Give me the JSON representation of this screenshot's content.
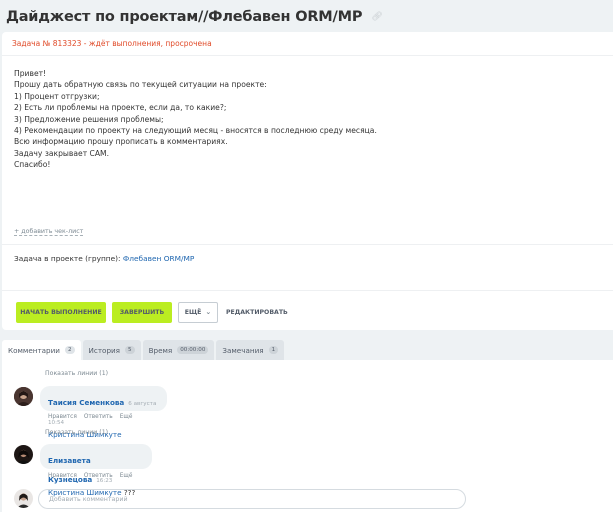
{
  "page": {
    "title": "Дайджест по проектам//Флебавен ORM/MP",
    "link_icon": "link-icon"
  },
  "task": {
    "header": "Задача № 813323 - ждёт выполнения, просрочена",
    "body_lines": [
      "Привет!",
      "",
      "Прошу дать обратную связь по текущей ситуации на проекте:",
      "1) Процент отгрузки;",
      "2) Есть ли проблемы на проекте, если да, то какие?;",
      "3) Предложение решения проблемы;",
      "4) Рекомендации по проекту на следующий месяц - вносятся в последнюю среду месяца.",
      "",
      "Всю информацию прошу прописать в комментариях.",
      "Задачу закрывает САМ.",
      "",
      "Спасибо!"
    ],
    "add_checklist": "+ добавить чек-лист",
    "project_label": "Задача в проекте (группе):",
    "project_name": "Флебавен ORM/MP",
    "buttons": {
      "start": "НАЧАТЬ ВЫПОЛНЕНИЕ",
      "finish": "ЗАВЕРШИТЬ",
      "more": "ЕЩЁ",
      "edit": "РЕДАКТИРОВАТЬ"
    }
  },
  "tabs": [
    {
      "label": "Комментарии",
      "count": "2"
    },
    {
      "label": "История",
      "count": "5"
    },
    {
      "label": "Время",
      "count": "00:00:00"
    },
    {
      "label": "Замечания",
      "count": "1"
    }
  ],
  "comments": {
    "show_more_1": "Показать линии (1)",
    "show_more_2": "Показать линии (1)",
    "items": [
      {
        "author": "Таисия Семенкова",
        "date": "6 августа 10:54",
        "mention": "Кристина Шимкуте",
        "text_after": "",
        "actions": [
          "Нравится",
          "Ответить",
          "Ещё"
        ]
      },
      {
        "author": "Елизавета Кузнецова",
        "date": "16:23",
        "mention": "Кристина Шимкуте",
        "text_after": " ???",
        "actions": [
          "Нравится",
          "Ответить",
          "Ещё"
        ]
      }
    ],
    "add_placeholder": "Добавить комментарий"
  },
  "colors": {
    "accent_green": "#bbed21",
    "link_blue": "#2067b0",
    "overdue_red": "#e04a28"
  }
}
